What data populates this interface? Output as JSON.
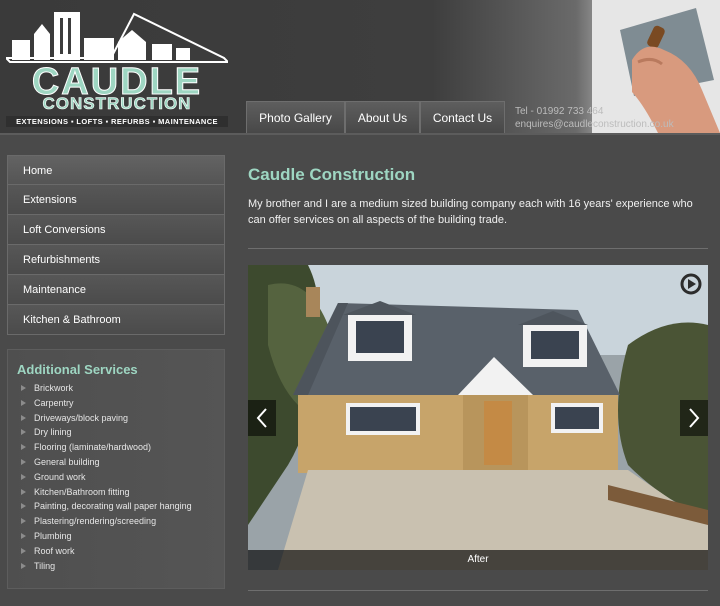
{
  "brand": {
    "name": "CAUDLE",
    "subtitle": "CONSTRUCTION",
    "tagline": "EXTENSIONS ▪ LOFTS ▪ REFURBS ▪ MAINTENANCE",
    "accent_color": "#9ed6c2"
  },
  "nav": {
    "tabs": [
      "Photo Gallery",
      "About Us",
      "Contact Us"
    ]
  },
  "contact": {
    "phone": "Tel - 01992 733 464",
    "email": "enquires@caudleconstruction.co.uk"
  },
  "side_menu": {
    "items": [
      "Home",
      "Extensions",
      "Loft Conversions",
      "Refurbishments",
      "Maintenance",
      "Kitchen & Bathroom"
    ]
  },
  "additional_services": {
    "title": "Additional Services",
    "items": [
      "Brickwork",
      "Carpentry",
      "Driveways/block paving",
      "Dry lining",
      "Flooring (laminate/hardwood)",
      "General building",
      "Ground work",
      "Kitchen/Bathroom fitting",
      "Painting, decorating wall paper hanging",
      "Plastering/rendering/screeding",
      "Plumbing",
      "Roof work",
      "Tiling"
    ]
  },
  "main": {
    "title": "Caudle Construction",
    "intro": "My brother and I are a medium sized building company each with 16 years' experience who can offer services on all aspects of the building trade."
  },
  "slider": {
    "caption": "After",
    "prev_icon": "chevron-left-icon",
    "next_icon": "chevron-right-icon",
    "play_icon": "play-icon"
  }
}
